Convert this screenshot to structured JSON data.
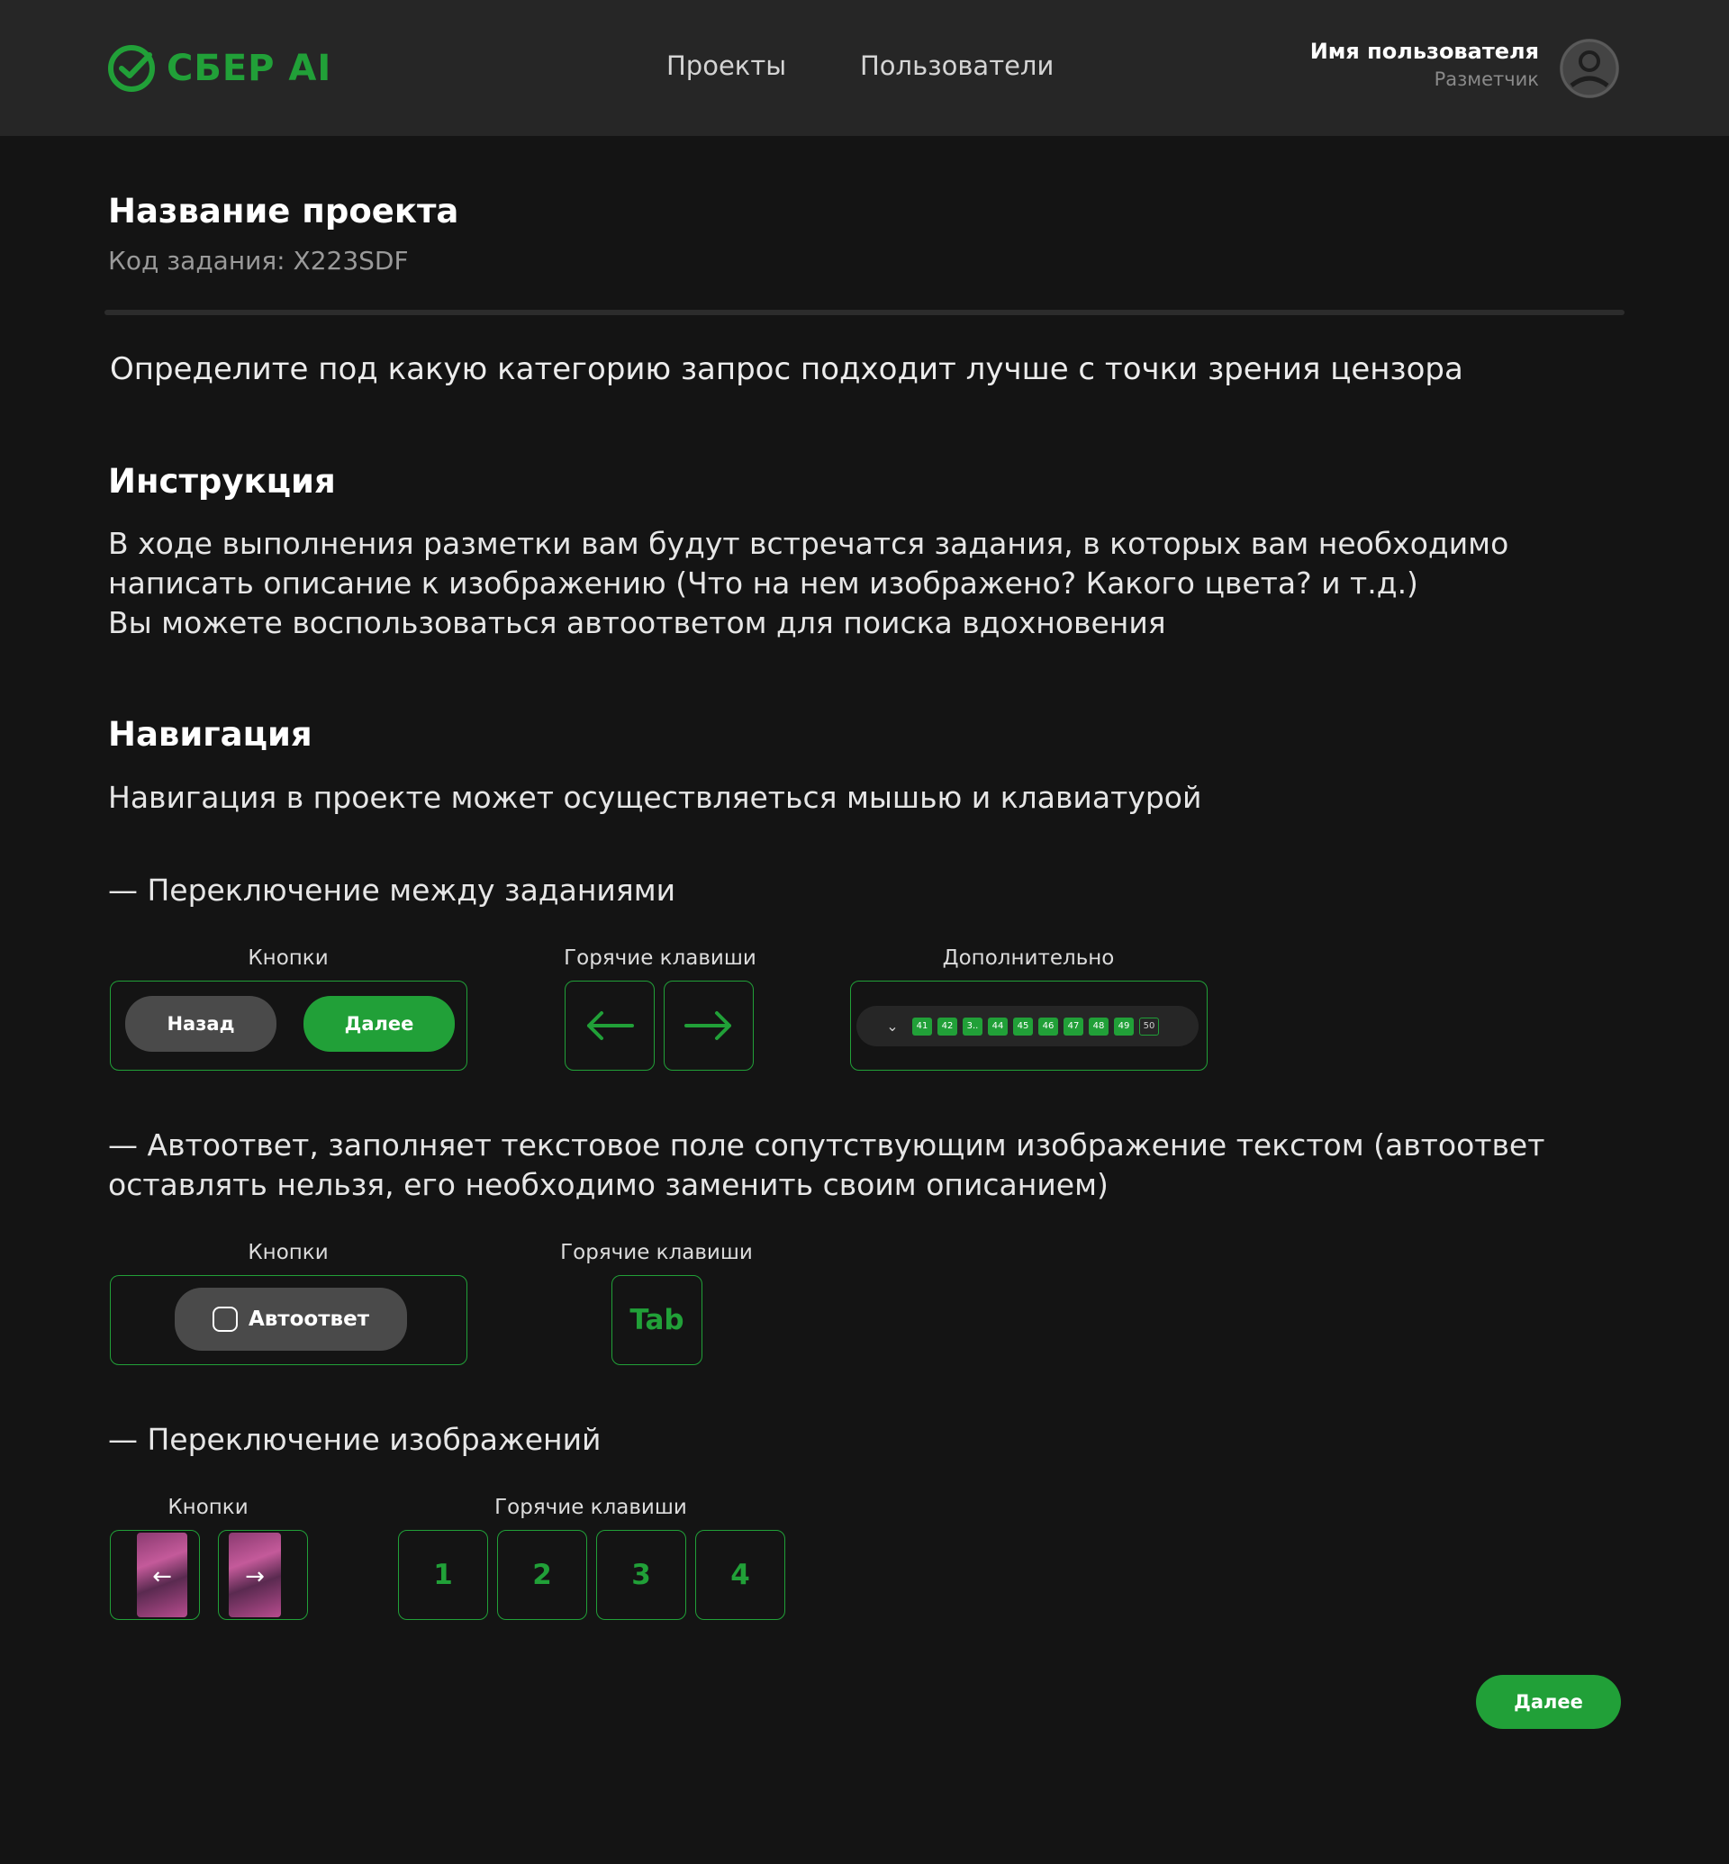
{
  "header": {
    "logo_text": "СБЕР AI",
    "nav": [
      "Проекты",
      "Пользователи"
    ],
    "user_name": "Имя пользователя",
    "user_role": "Разметчик"
  },
  "project": {
    "title": "Название проекта",
    "code": "Код задания: X223SDF"
  },
  "task_text": "Определите под какую категорию запрос подходит лучше с точки зрения цензора",
  "instruction": {
    "title": "Инструкция",
    "lines": [
      "В ходе выполнения разметки вам будут встречатся задания, в которых вам необходимо",
      "написать описание к изображению (Что на нем изображено? Какого цвета? и т.д.)",
      "Вы можете воспользоваться автоответом для поиска вдохновения"
    ]
  },
  "navigation": {
    "title": "Навигация",
    "text": "Навигация в проекте может осуществляеться мышью и клавиатурой",
    "switch_tasks": {
      "heading": "— Переключение между заданиями",
      "buttons_label": "Кнопки",
      "hotkeys_label": "Горячие клавиши",
      "extra_label": "Дополнительно",
      "back_label": "Назад",
      "next_label": "Далее",
      "pages": [
        "41",
        "42",
        "3..",
        "44",
        "45",
        "46",
        "47",
        "48",
        "49",
        "50"
      ],
      "current_page": "50"
    },
    "autoanswer": {
      "heading_line1": "— Автоответ, заполняет текстовое поле сопутствующим изображение текстом (автоответ",
      "heading_line2": "оставлять нельзя, его необходимо заменить своим описанием)",
      "buttons_label": "Кнопки",
      "hotkeys_label": "Горячие клавиши",
      "button_label": "Автоответ",
      "hotkey": "Tab"
    },
    "switch_images": {
      "heading": "— Переключение изображений",
      "buttons_label": "Кнопки",
      "hotkeys_label": "Горячие клавиши",
      "keys": [
        "1",
        "2",
        "3",
        "4"
      ]
    }
  },
  "footer": {
    "next_label": "Далее"
  },
  "colors": {
    "accent": "#21A038",
    "background": "#141414",
    "header_bg": "#262626"
  }
}
